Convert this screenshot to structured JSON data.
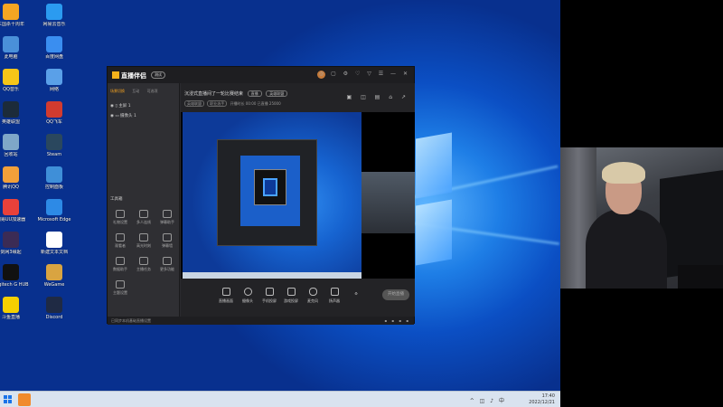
{
  "desktop": {
    "icons": [
      {
        "label": "三国杀十周年",
        "color": "#f5a623"
      },
      {
        "label": "网易云音乐",
        "color": "#2b9bf0"
      },
      {
        "label": "此电脑",
        "color": "#4a90d9"
      },
      {
        "label": "百度网盘",
        "color": "#3a8ef0"
      },
      {
        "label": "QQ音乐",
        "color": "#f5c518"
      },
      {
        "label": "网络",
        "color": "#5aa0e8"
      },
      {
        "label": "英雄联盟",
        "color": "#1c2b3a"
      },
      {
        "label": "QQ飞车",
        "color": "#d23b2f"
      },
      {
        "label": "回收站",
        "color": "#7fa7c8"
      },
      {
        "label": "Steam",
        "color": "#2a475e"
      },
      {
        "label": "腾讯QQ",
        "color": "#f2a03a"
      },
      {
        "label": "控制面板",
        "color": "#3f8fd8"
      },
      {
        "label": "网易UU加速器",
        "color": "#e8413a"
      },
      {
        "label": "Microsoft Edge",
        "color": "#2d8ae6"
      },
      {
        "label": "剑网3缘起",
        "color": "#3b2b55"
      },
      {
        "label": "新建文本文档",
        "color": "#ffffff"
      },
      {
        "label": "Logitech G HUB",
        "color": "#111111"
      },
      {
        "label": "WeGame",
        "color": "#d9a441"
      },
      {
        "label": "斗鱼直播",
        "color": "#f5d000"
      },
      {
        "label": "Discord",
        "color": "#1f2a44"
      },
      {
        "label": "Steam",
        "color": "#1b2838"
      },
      {
        "label": "Logitech G HUB",
        "color": "#222222"
      },
      {
        "label": "直播伴侣",
        "color": "#f5b21b"
      },
      {
        "label": "PUBG",
        "color": "#3b3b3b"
      }
    ]
  },
  "taskbar": {
    "time": "17:40",
    "date": "2022/12/21"
  },
  "app": {
    "name": "直播伴侣",
    "version": "测试",
    "sidebar": {
      "tabs": [
        "场景切换",
        "互动",
        "可选项"
      ],
      "scenes": [
        "主屏 1",
        "摄像头 1"
      ],
      "tools_title": "工具箱",
      "tools": [
        "礼物设置",
        "多人连线",
        "弹幕助手",
        "观看者",
        "高光时刻",
        "弹幕墙",
        "数据助手",
        "主播任务",
        "更多功能",
        "主题设置"
      ]
    },
    "main": {
      "title": "沉浸式直播间了一轮比赛结束",
      "title_tag": "直播",
      "category": "英雄联盟",
      "sub_tags": [
        "英雄联盟",
        "职业选手"
      ],
      "sub_text": "开播时长 00:00 已直播 25000"
    },
    "controls": [
      "直播画面",
      "摄像头",
      "手机投屏",
      "游戏投屏",
      "麦克风",
      "扬声器"
    ],
    "live_button": "开始直播",
    "status_text": "已同步本机基础直播设置"
  }
}
